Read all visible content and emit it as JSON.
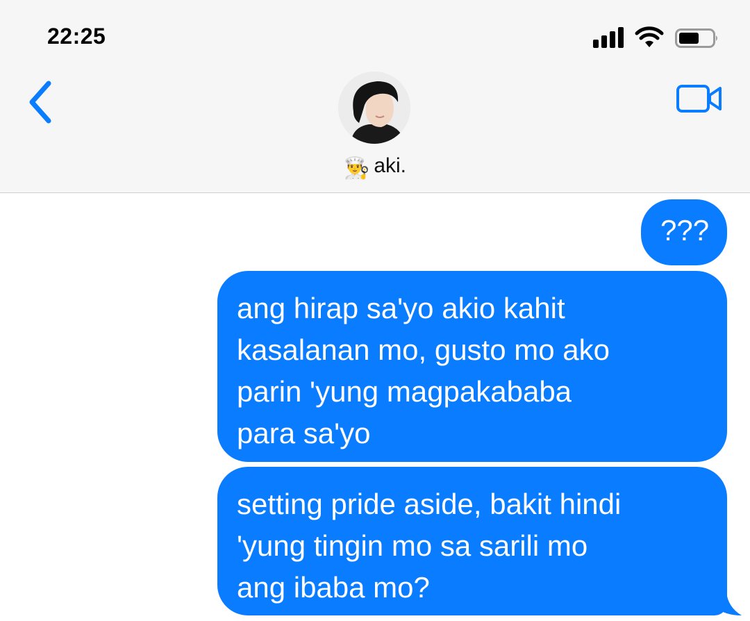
{
  "status_bar": {
    "time": "22:25",
    "icons": [
      "signal-icon",
      "wifi-icon",
      "battery-icon"
    ]
  },
  "header": {
    "back_icon": "chevron-left-icon",
    "video_icon": "video-camera-icon",
    "contact_emoji": "👨‍🍳",
    "contact_name": "aki."
  },
  "colors": {
    "accent": "#0a7cff",
    "header_bg": "#f6f6f7",
    "bubble_text": "#ffffff"
  },
  "messages": [
    {
      "sender": "me",
      "lines": [
        "???"
      ]
    },
    {
      "sender": "me",
      "lines": [
        "ang hirap sa'yo akio kahit",
        "kasalanan mo, gusto mo ako",
        "parin 'yung magpakababa",
        "para sa'yo"
      ]
    },
    {
      "sender": "me",
      "lines": [
        "setting pride aside, bakit hindi",
        "'yung tingin mo sa sarili mo",
        "ang ibaba mo?"
      ]
    }
  ]
}
